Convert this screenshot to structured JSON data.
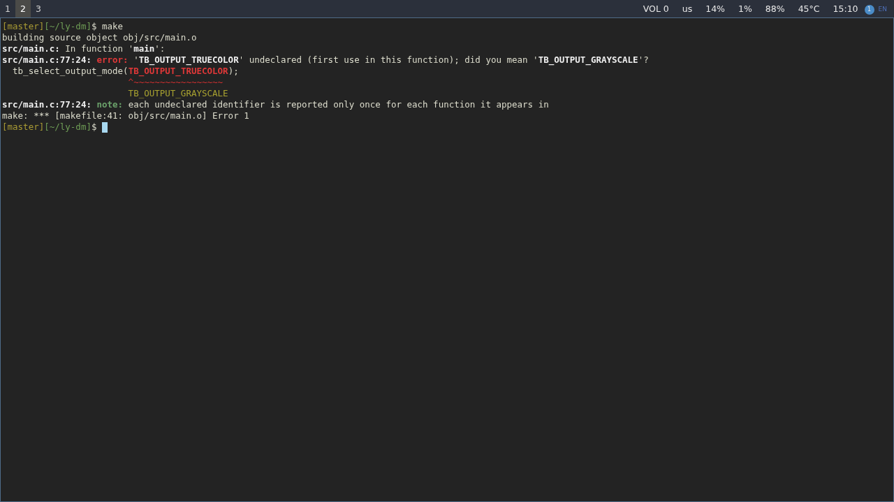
{
  "topbar": {
    "workspaces": [
      {
        "label": "1",
        "selected": false
      },
      {
        "label": "2",
        "selected": true
      },
      {
        "label": "3",
        "selected": false
      }
    ],
    "status": [
      "VOL 0",
      "us",
      "14%",
      "1%",
      "88%",
      "45°C",
      "15:10"
    ],
    "notification_count": "1",
    "layout": "EN"
  },
  "terminal": {
    "lines": [
      {
        "segments": [
          {
            "kind": "branch",
            "text": "[master]"
          },
          {
            "kind": "path",
            "text": "[~/ly-dm]"
          },
          {
            "kind": "plain",
            "text": "$ make"
          }
        ]
      },
      {
        "segments": [
          {
            "kind": "plain",
            "text": "building source object obj/src/main.o"
          }
        ]
      },
      {
        "segments": [
          {
            "kind": "bold",
            "text": "src/main.c:"
          },
          {
            "kind": "plain",
            "text": " In function '"
          },
          {
            "kind": "bold",
            "text": "main"
          },
          {
            "kind": "plain",
            "text": "':"
          }
        ]
      },
      {
        "segments": [
          {
            "kind": "bold",
            "text": "src/main.c:77:24: "
          },
          {
            "kind": "error",
            "text": "error:"
          },
          {
            "kind": "plain",
            "text": " '"
          },
          {
            "kind": "bold",
            "text": "TB_OUTPUT_TRUECOLOR"
          },
          {
            "kind": "plain",
            "text": "' undeclared (first use in this function); did you mean '"
          },
          {
            "kind": "bold",
            "text": "TB_OUTPUT_GRAYSCALE"
          },
          {
            "kind": "plain",
            "text": "'?"
          }
        ]
      },
      {
        "segments": [
          {
            "kind": "plain",
            "text": "  tb_select_output_mode("
          },
          {
            "kind": "error",
            "text": "TB_OUTPUT_TRUECOLOR"
          },
          {
            "kind": "plain",
            "text": ");"
          }
        ]
      },
      {
        "segments": [
          {
            "kind": "caret",
            "text": "                        ^~~~~~~~~~~~~~~~~~"
          }
        ]
      },
      {
        "segments": [
          {
            "kind": "fixit",
            "text": "                        TB_OUTPUT_GRAYSCALE"
          }
        ]
      },
      {
        "segments": [
          {
            "kind": "bold",
            "text": "src/main.c:77:24: "
          },
          {
            "kind": "note",
            "text": "note:"
          },
          {
            "kind": "plain",
            "text": " each undeclared identifier is reported only once for each function it appears in"
          }
        ]
      },
      {
        "segments": [
          {
            "kind": "plain",
            "text": "make: *** [makefile:41: obj/src/main.o] Error 1"
          }
        ]
      },
      {
        "segments": [
          {
            "kind": "branch",
            "text": "[master]"
          },
          {
            "kind": "path",
            "text": "[~/ly-dm]"
          },
          {
            "kind": "plain",
            "text": "$ "
          }
        ],
        "cursor": true
      }
    ]
  }
}
